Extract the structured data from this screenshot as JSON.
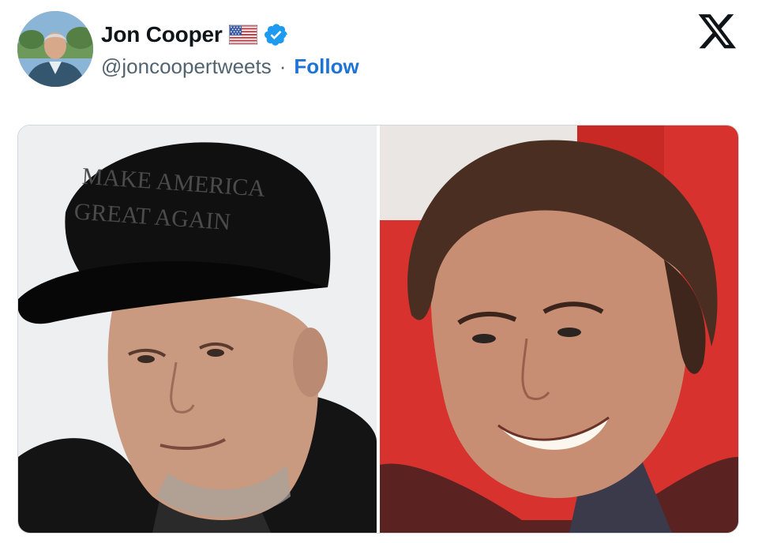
{
  "tweet": {
    "author": {
      "name": "Jon Cooper",
      "handle": "@joncoopertweets",
      "separator": "·",
      "follow_label": "Follow",
      "flag_icon": "us-flag-icon",
      "verified_icon": "verified-badge-icon",
      "avatar": "profile-avatar"
    },
    "platform_icon": "x-logo-icon",
    "media": [
      {
        "name": "left-photo",
        "hat_text_line1": "MAKE AMERICA",
        "hat_text_line2": "GREAT AGAIN"
      },
      {
        "name": "right-photo"
      }
    ]
  },
  "colors": {
    "follow": "#1d74d6",
    "verified": "#1d9bf0",
    "handle": "#536471",
    "border": "#cfd9de"
  }
}
